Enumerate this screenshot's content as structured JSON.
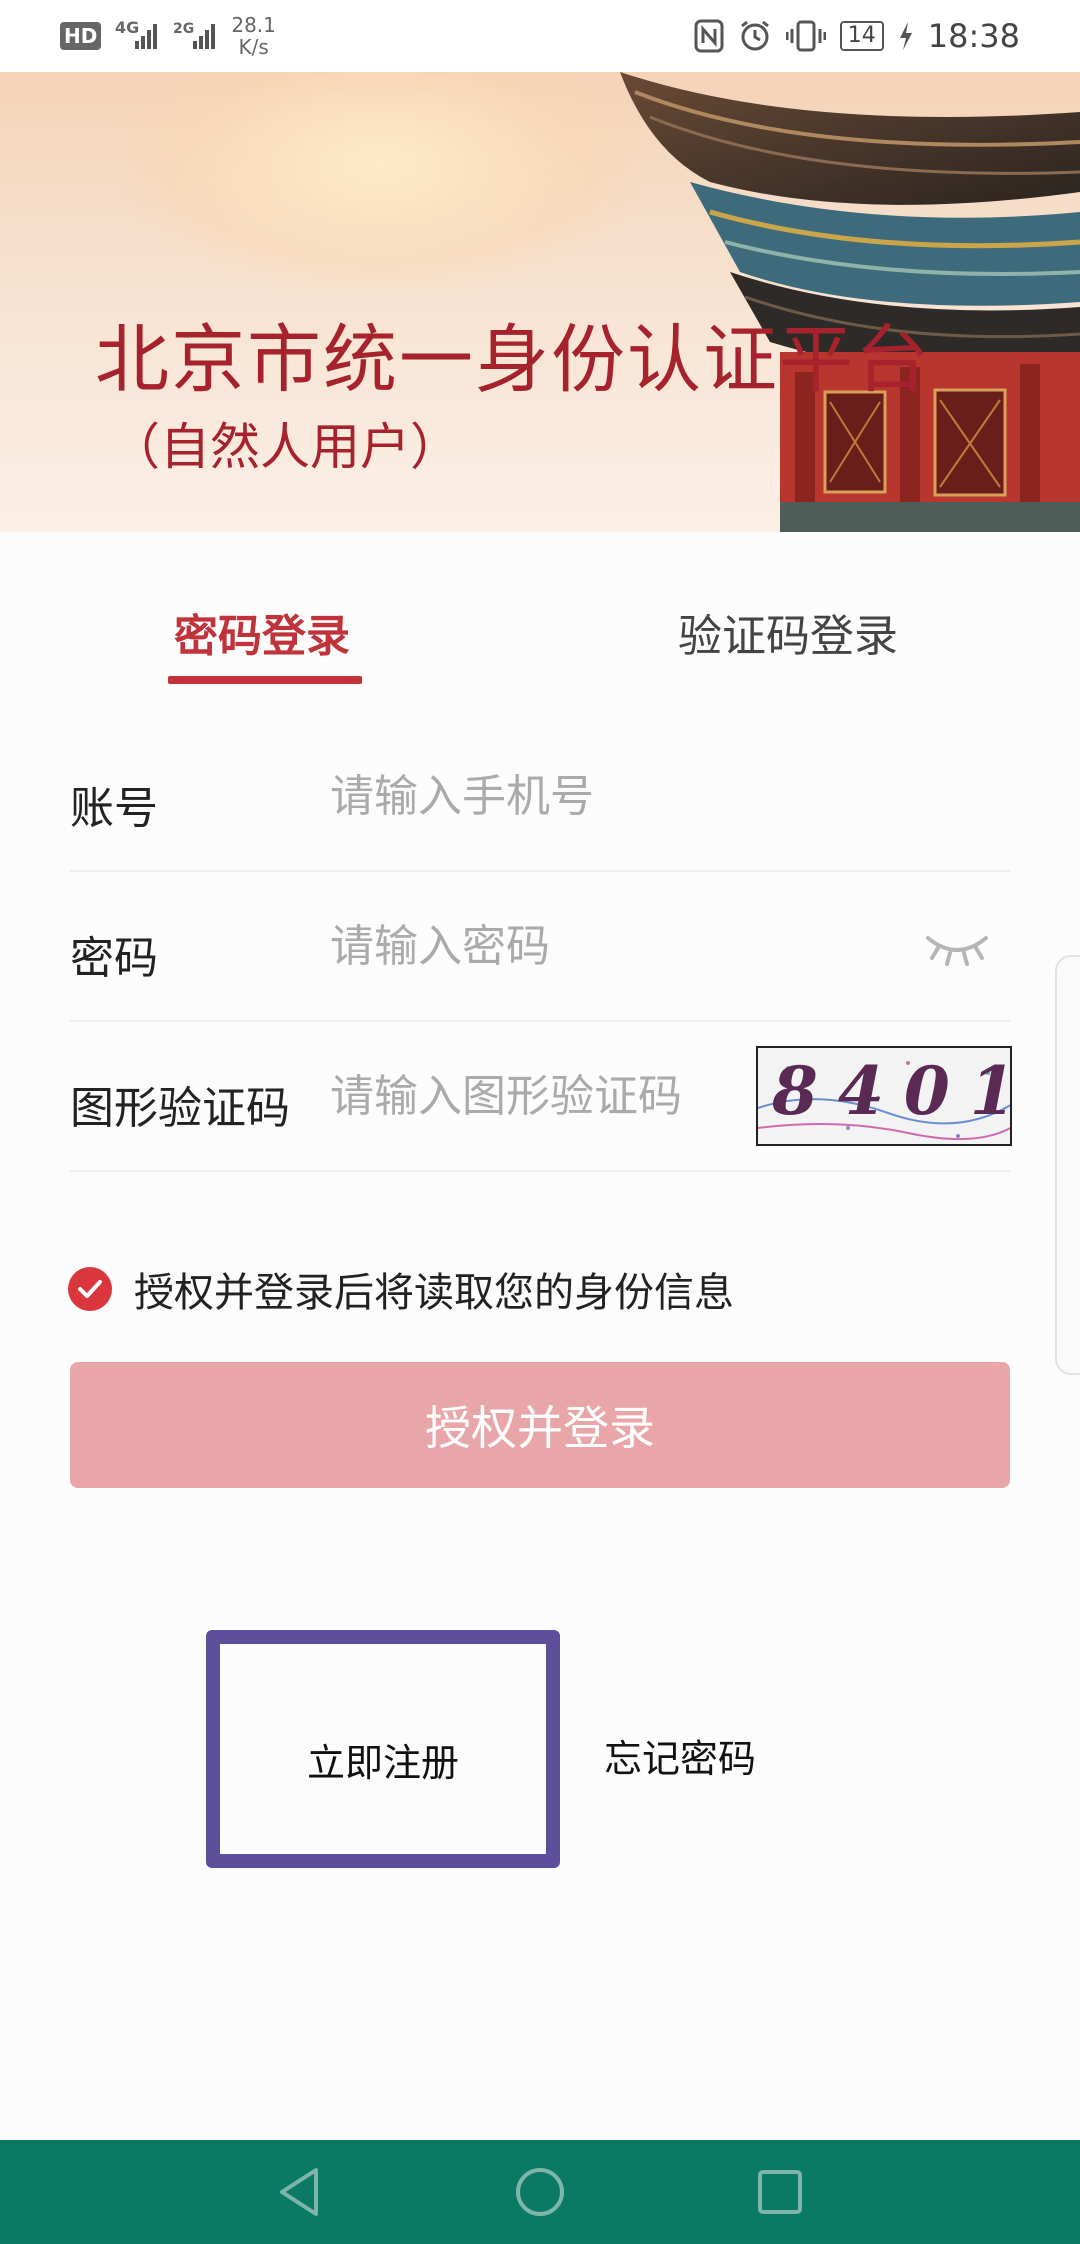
{
  "status_bar": {
    "hd": "HD",
    "signal1": "4G",
    "signal2": "2G",
    "net_speed_value": "28.1",
    "net_speed_unit": "K/s",
    "battery": "14",
    "time": "18:38"
  },
  "banner": {
    "title": "北京市统一身份认证平台",
    "subtitle": "（自然人用户）"
  },
  "tabs": [
    {
      "label": "密码登录",
      "active": true
    },
    {
      "label": "验证码登录",
      "active": false
    }
  ],
  "form": {
    "account_label": "账号",
    "account_placeholder": "请输入手机号",
    "password_label": "密码",
    "password_placeholder": "请输入密码",
    "captcha_label": "图形验证码",
    "captcha_placeholder": "请输入图形验证码",
    "captcha_code": "8401"
  },
  "consent": {
    "checked": true,
    "text": "授权并登录后将读取您的身份信息"
  },
  "login_button": "授权并登录",
  "links": {
    "register": "立即注册",
    "forgot": "忘记密码"
  },
  "colors": {
    "accent": "#c0333b",
    "button_disabled": "#e8a6a8",
    "nav_bar": "#0a7a64",
    "highlight_box": "#5d4f9a"
  },
  "icons": [
    "eye-closed-icon",
    "check-icon",
    "back-icon",
    "home-icon",
    "recents-icon"
  ]
}
